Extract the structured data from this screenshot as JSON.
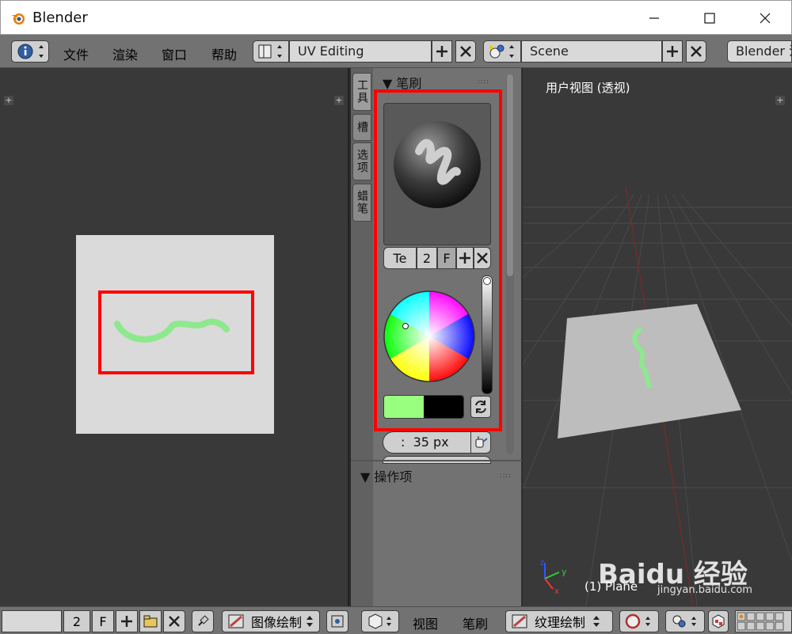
{
  "window": {
    "title": "Blender",
    "logo_color": "#e87d0d"
  },
  "header": {
    "menus": [
      "文件",
      "渲染",
      "窗口",
      "帮助"
    ],
    "screen_layout": "UV Editing",
    "scene": "Scene",
    "engine": "Blender 渲"
  },
  "image_editor": {
    "stroke_color": "#8ee88e",
    "bottom": {
      "users": "2",
      "fake_user": "F",
      "mode": "图像绘制"
    }
  },
  "tool_shelf": {
    "tabs": [
      "工具",
      "槽",
      "选项",
      "蜡笔"
    ],
    "active_tab": "工具",
    "brush_panel": {
      "title": "▼ 笔刷",
      "brush_name": "Te",
      "users": "2",
      "fake_user": "F",
      "primary_color": "#99ff7f",
      "secondary_color": "#000000",
      "radius_label": ":",
      "radius_value": "35 px"
    },
    "operator_panel": {
      "title": "▼ 操作项"
    }
  },
  "viewport": {
    "view_name": "用户视图 (透视)",
    "object_name": "(1) Plane",
    "watermark": "Baidu 经验",
    "watermark_url": "jingyan.baidu.com",
    "bottom": {
      "view_menu": "视图",
      "brush_menu": "笔刷",
      "mode": "纹理绘制"
    }
  }
}
